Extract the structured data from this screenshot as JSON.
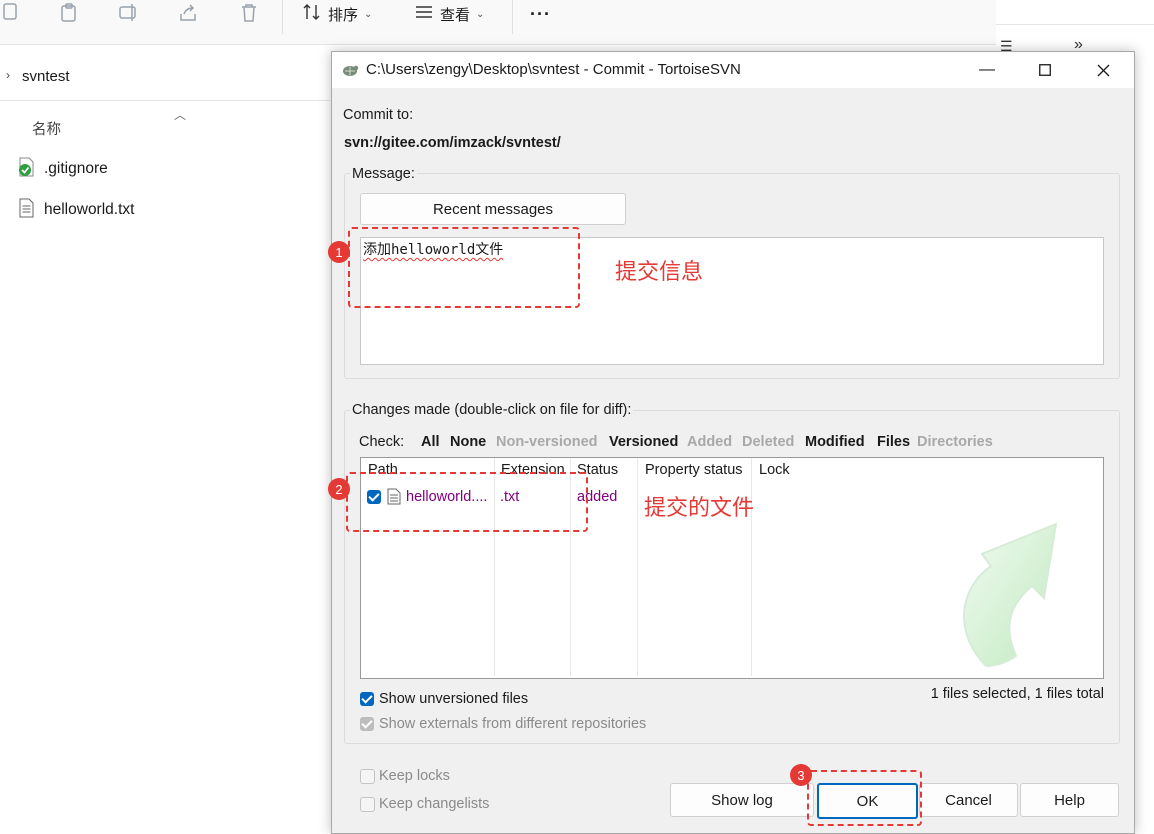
{
  "explorer": {
    "toolbar": {
      "sort_label": "排序",
      "view_label": "查看",
      "more_label": "···"
    },
    "breadcrumb": "svntest",
    "column_header": "名称",
    "files": [
      {
        "name": ".gitignore",
        "icon": "svn-normal-file-icon"
      },
      {
        "name": "helloworld.txt",
        "icon": "text-file-icon"
      }
    ]
  },
  "dialog": {
    "title": "C:\\Users\\zengy\\Desktop\\svntest - Commit - TortoiseSVN",
    "commit_to_label": "Commit to:",
    "commit_url": "svn://gitee.com/imzack/svntest/",
    "message_group_label": "Message:",
    "recent_messages_button": "Recent messages",
    "message_text": "添加helloworld文件",
    "changes_group_label": "Changes made (double-click on file for diff):",
    "check_label": "Check:",
    "filters": [
      {
        "label": "All",
        "enabled": true
      },
      {
        "label": "None",
        "enabled": true
      },
      {
        "label": "Non-versioned",
        "enabled": false
      },
      {
        "label": "Versioned",
        "enabled": true
      },
      {
        "label": "Added",
        "enabled": false
      },
      {
        "label": "Deleted",
        "enabled": false
      },
      {
        "label": "Modified",
        "enabled": true
      },
      {
        "label": "Files",
        "enabled": true
      },
      {
        "label": "Directories",
        "enabled": false
      }
    ],
    "columns": [
      "Path",
      "Extension",
      "Status",
      "Property status",
      "Lock"
    ],
    "rows": [
      {
        "checked": true,
        "path": "helloworld....",
        "extension": ".txt",
        "status": "added",
        "property_status": "",
        "lock": ""
      }
    ],
    "show_unversioned_label": "Show unversioned files",
    "show_externals_label": "Show externals from different repositories",
    "selection_summary": "1 files selected, 1 files total",
    "keep_locks_label": "Keep locks",
    "keep_changelists_label": "Keep changelists",
    "buttons": {
      "show_log": "Show log",
      "ok": "OK",
      "cancel": "Cancel",
      "help": "Help"
    }
  },
  "annotations": {
    "badge1": "1",
    "badge2": "2",
    "badge3": "3",
    "commit_message_note": "提交信息",
    "commit_files_note": "提交的文件"
  },
  "colors": {
    "accent": "#0067c0",
    "annotation_red": "#e53935",
    "svn_added_text": "#800080"
  }
}
